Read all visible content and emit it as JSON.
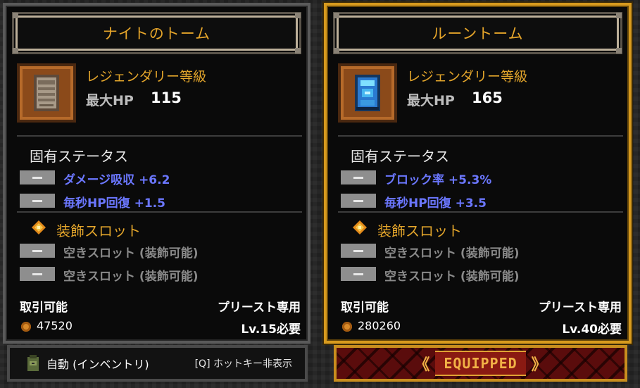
{
  "left_card": {
    "title": "ナイトのトーム",
    "grade": "レジェンダリー等級",
    "stat_label": "最大HP",
    "stat_value": "115",
    "innate_header": "固有ステータス",
    "innate_stats": [
      "ダメージ吸収 +6.2",
      "毎秒HP回復 +1.5"
    ],
    "slot_header": "装飾スロット",
    "slots": [
      "空きスロット (装飾可能)",
      "空きスロット (装飾可能)"
    ],
    "tradeable": "取引可能",
    "class_only": "プリースト専用",
    "price": "47520",
    "level_req": "Lv.15必要"
  },
  "right_card": {
    "title": "ルーントーム",
    "grade": "レジェンダリー等級",
    "stat_label": "最大HP",
    "stat_value": "165",
    "innate_header": "固有ステータス",
    "innate_stats": [
      "ブロック率 +5.3%",
      "毎秒HP回復 +3.5"
    ],
    "slot_header": "装飾スロット",
    "slots": [
      "空きスロット (装飾可能)",
      "空きスロット (装飾可能)"
    ],
    "tradeable": "取引可能",
    "class_only": "プリースト専用",
    "price": "280260",
    "level_req": "Lv.40必要"
  },
  "bottom": {
    "auto_label": "自動 (インベントリ)",
    "hotkey_label": "[Q] ホットキー非表示",
    "equipped_label": "EQUIPPED"
  },
  "colors": {
    "gold": "#e3a52b",
    "stat_blue": "#6b77ff",
    "equipped_border": "#d79a1e"
  }
}
